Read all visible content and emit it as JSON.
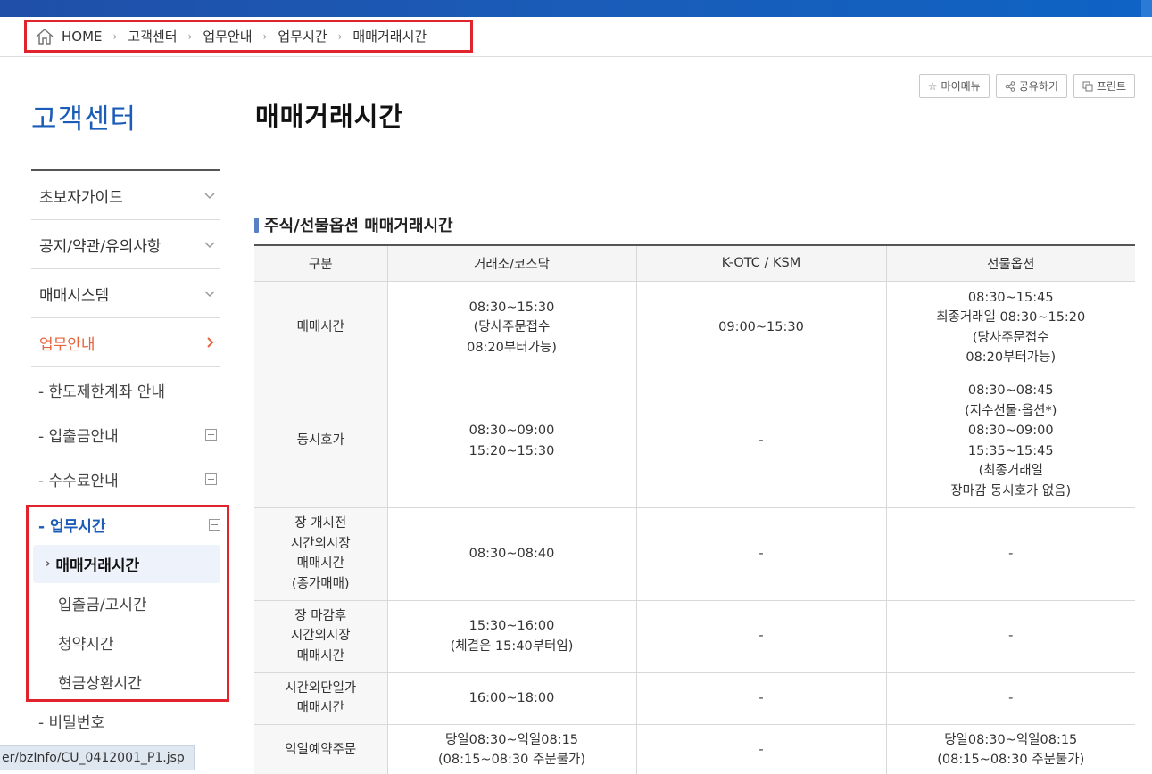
{
  "breadcrumb": [
    "HOME",
    "고객센터",
    "업무안내",
    "업무시간",
    "매매거래시간"
  ],
  "breadcrumb_sep": "›",
  "sidebar": {
    "title": "고객센터",
    "main_items": [
      {
        "label": "초보자가이드"
      },
      {
        "label": "공지/약관/유의사항"
      },
      {
        "label": "매매시스템"
      },
      {
        "label": "업무안내"
      }
    ],
    "sub_items": [
      {
        "label": "- 한도제한계좌 안내"
      },
      {
        "label": "- 입출금안내"
      },
      {
        "label": "- 수수료안내"
      }
    ],
    "expanded": {
      "label": "- 업무시간",
      "items": [
        {
          "label": "매매거래시간",
          "current": true
        },
        {
          "label": "입출금/고시간"
        },
        {
          "label": "청약시간"
        },
        {
          "label": "현금상환시간"
        }
      ]
    },
    "last_item": "- 비밀번호"
  },
  "status_url": "er/bzInfo/CU_0412001_P1.jsp",
  "utility": {
    "mymenu": "마이메뉴",
    "share": "공유하기",
    "print": "프린트"
  },
  "page_title": "매매거래시간",
  "section_title": "주식/선물옵션 매매거래시간",
  "table": {
    "headers": [
      "구분",
      "거래소/코스닥",
      "K-OTC / KSM",
      "선물옵션"
    ],
    "rows": [
      [
        "매매시간",
        "08:30~15:30\n(당사주문접수\n08:20부터가능)",
        "09:00~15:30",
        "08:30~15:45\n최종거래일 08:30~15:20\n(당사주문접수\n08:20부터가능)"
      ],
      [
        "동시호가",
        "08:30~09:00\n15:20~15:30",
        "-",
        "08:30~08:45\n(지수선물·옵션*)\n08:30~09:00\n15:35~15:45\n(최종거래일\n장마감 동시호가 없음)"
      ],
      [
        "장 개시전\n시간외시장\n매매시간\n(종가매매)",
        "08:30~08:40",
        "-",
        "-"
      ],
      [
        "장 마감후\n시간외시장\n매매시간",
        "15:30~16:00\n(체결은 15:40부터임)",
        "-",
        "-"
      ],
      [
        "시간외단일가\n매매시간",
        "16:00~18:00",
        "-",
        "-"
      ],
      [
        "익일예약주문",
        "당일08:30~익일08:15\n(08:15~08:30 주문불가)",
        "-",
        "당일08:30~익일08:15\n(08:15~08:30 주문불가)"
      ]
    ]
  },
  "colors": {
    "accent_blue": "#1a5cb8",
    "active_orange": "#e8643c",
    "highlight_red": "#e1232e"
  }
}
